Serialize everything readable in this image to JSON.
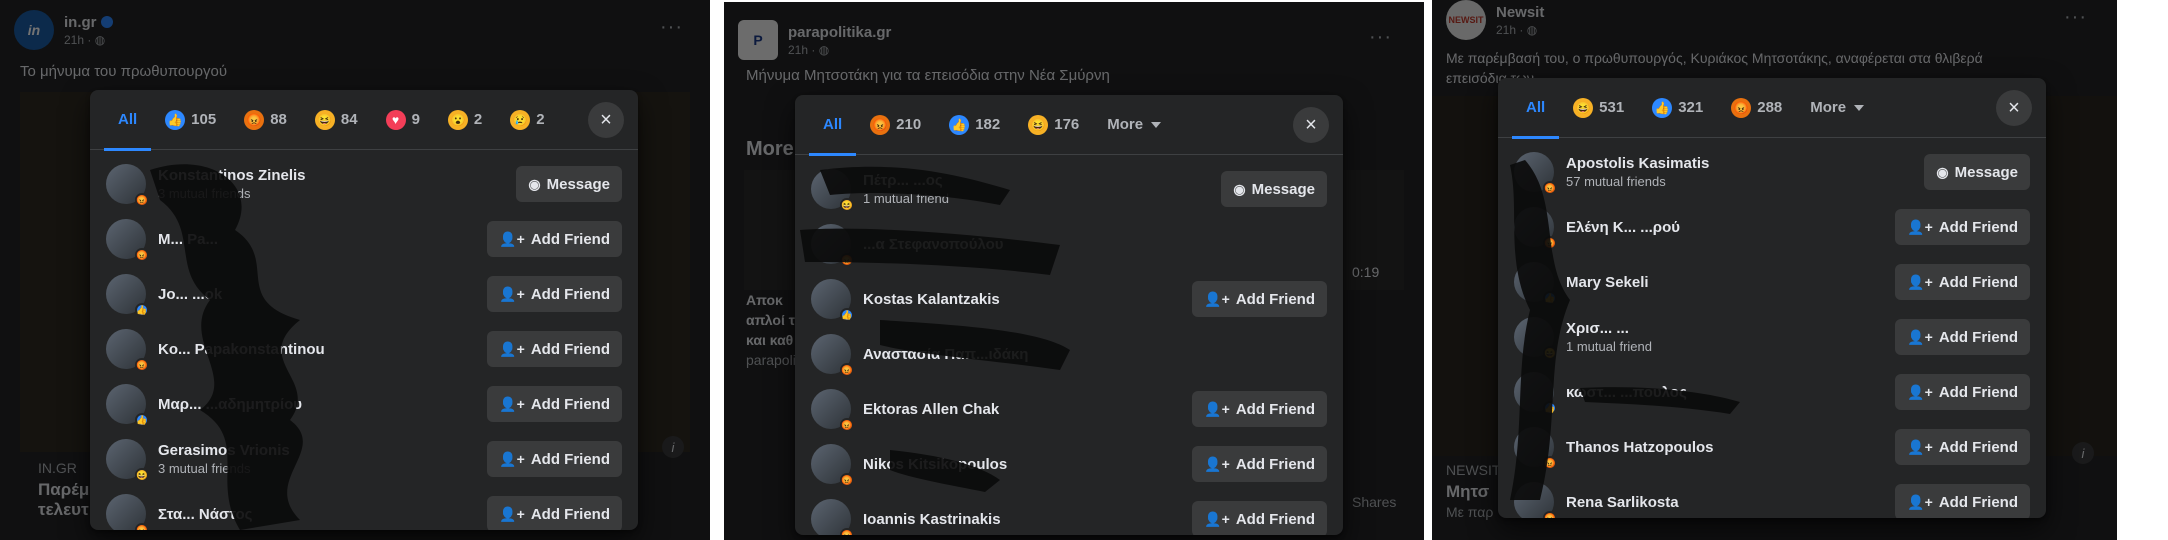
{
  "feeds": [
    {
      "page_name": "in.gr",
      "time": "21h · ",
      "logo_text": "in",
      "post_text": "Το μήνυμα του πρωθυπουργού",
      "bottom_source": "IN.GR",
      "bottom_title_1": "Παρέμ",
      "bottom_title_2": "τελευτ"
    },
    {
      "page_name": "parapolitika.gr",
      "time": "21h · ",
      "logo_text": "P",
      "post_text": "Μήνυμα Μητσοτάκη για τα επεισόδια στην Νέα Σμύρνη",
      "more_label": "More",
      "video_time": "0:19",
      "side_text_1": "Αποκ",
      "side_text_2": "απλοί τ",
      "side_text_3": "και καθ",
      "side_text_4": "parapoli",
      "shares_label": "Shares"
    },
    {
      "page_name": "Newsit",
      "time": "21h · ",
      "logo_text": "NEWSIT",
      "post_text": "Με παρέμβασή του, ο πρωθυπουργός, Κυριάκος Μητσοτάκης, αναφέρεται στα θλιβερά",
      "post_text_2": "επεισόδια των ...",
      "bottom_source": "NEWSIT",
      "bottom_title_1": "Μητσ",
      "bottom_title_2": "Με παρ"
    }
  ],
  "dialogs": [
    {
      "tabs": [
        {
          "label": "All",
          "reaction": null,
          "active": true
        },
        {
          "label": "105",
          "reaction": "like"
        },
        {
          "label": "88",
          "reaction": "angry"
        },
        {
          "label": "84",
          "reaction": "haha"
        },
        {
          "label": "9",
          "reaction": "love"
        },
        {
          "label": "2",
          "reaction": "wow"
        },
        {
          "label": "2",
          "reaction": "sad"
        }
      ],
      "close_icon": "×",
      "rows": [
        {
          "name": "Konstantinos Zinelis",
          "sub": "3 mutual friends",
          "reaction": "angry",
          "button": "Message",
          "button_icon": "messenger-icon"
        },
        {
          "name": "M... Pa...",
          "sub": "",
          "reaction": "angry",
          "button": "Add Friend",
          "button_icon": "add-friend-icon"
        },
        {
          "name": "Jo... ...ok",
          "sub": "",
          "reaction": "like",
          "button": "Add Friend",
          "button_icon": "add-friend-icon"
        },
        {
          "name": "Ko... Papakonstantinou",
          "sub": "",
          "reaction": "angry",
          "button": "Add Friend",
          "button_icon": "add-friend-icon"
        },
        {
          "name": "Μαρ... ...αδημητρίου",
          "sub": "",
          "reaction": "like",
          "button": "Add Friend",
          "button_icon": "add-friend-icon"
        },
        {
          "name": "Gerasimos Vrionis",
          "sub": "3 mutual friends",
          "reaction": "haha",
          "button": "Add Friend",
          "button_icon": "add-friend-icon"
        },
        {
          "name": "Στα... Νάστος",
          "sub": "",
          "reaction": "angry",
          "button": "Add Friend",
          "button_icon": "add-friend-icon"
        }
      ]
    },
    {
      "tabs": [
        {
          "label": "All",
          "reaction": null,
          "active": true
        },
        {
          "label": "210",
          "reaction": "angry"
        },
        {
          "label": "182",
          "reaction": "like"
        },
        {
          "label": "176",
          "reaction": "haha"
        },
        {
          "label": "More",
          "reaction": null,
          "dropdown": true
        }
      ],
      "close_icon": "×",
      "rows": [
        {
          "name": "Πέτρ... ...ος",
          "sub": "1 mutual friend",
          "reaction": "haha",
          "button": "Message",
          "button_icon": "messenger-icon"
        },
        {
          "name": "...α Στεφανοπούλου",
          "sub": "",
          "reaction": "angry",
          "button": "",
          "button_icon": ""
        },
        {
          "name": "Kostas Kalantzakis",
          "sub": "",
          "reaction": "like",
          "button": "Add Friend",
          "button_icon": "add-friend-icon"
        },
        {
          "name": "Αναστασία Παπ...ιδάκη",
          "sub": "",
          "reaction": "angry",
          "button": "",
          "button_icon": ""
        },
        {
          "name": "Ektoras Allen Chak",
          "sub": "",
          "reaction": "angry",
          "button": "Add Friend",
          "button_icon": "add-friend-icon"
        },
        {
          "name": "Nikos Kitsikopoulos",
          "sub": "",
          "reaction": "angry",
          "button": "Add Friend",
          "button_icon": "add-friend-icon"
        },
        {
          "name": "Ioannis Kastrinakis",
          "sub": "",
          "reaction": "angry",
          "button": "Add Friend",
          "button_icon": "add-friend-icon"
        }
      ]
    },
    {
      "tabs": [
        {
          "label": "All",
          "reaction": null,
          "active": true
        },
        {
          "label": "531",
          "reaction": "haha"
        },
        {
          "label": "321",
          "reaction": "like"
        },
        {
          "label": "288",
          "reaction": "angry"
        },
        {
          "label": "More",
          "reaction": null,
          "dropdown": true
        }
      ],
      "close_icon": "×",
      "rows": [
        {
          "name": "Apostolis Kasimatis",
          "sub": "57 mutual friends",
          "reaction": "angry",
          "button": "Message",
          "button_icon": "messenger-icon"
        },
        {
          "name": "Ελένη Κ... ...ρού",
          "sub": "",
          "reaction": "angry",
          "button": "Add Friend",
          "button_icon": "add-friend-icon"
        },
        {
          "name": "Mary Sekeli",
          "sub": "",
          "reaction": "like",
          "button": "Add Friend",
          "button_icon": "add-friend-icon"
        },
        {
          "name": "Χρισ... ...",
          "sub": "1 mutual friend",
          "reaction": "haha",
          "button": "Add Friend",
          "button_icon": "add-friend-icon"
        },
        {
          "name": "κωστ... ...πουλος",
          "sub": "",
          "reaction": "like",
          "button": "Add Friend",
          "button_icon": "add-friend-icon"
        },
        {
          "name": "Thanos Hatzopoulos",
          "sub": "",
          "reaction": "angry",
          "button": "Add Friend",
          "button_icon": "add-friend-icon"
        },
        {
          "name": "Rena Sarlikosta",
          "sub": "",
          "reaction": "angry",
          "button": "Add Friend",
          "button_icon": "add-friend-icon"
        }
      ]
    }
  ],
  "icons": {
    "like": "👍",
    "angry": "😡",
    "haha": "😆",
    "love": "♥",
    "wow": "😮",
    "sad": "😢",
    "messenger": "◉",
    "add_friend": "👤+",
    "dots": "···",
    "info": "i"
  },
  "colors": {
    "accent": "#2d88ff",
    "dialog_bg": "#242526",
    "button_bg": "#3a3b3c",
    "feed_bg": "#242526"
  }
}
